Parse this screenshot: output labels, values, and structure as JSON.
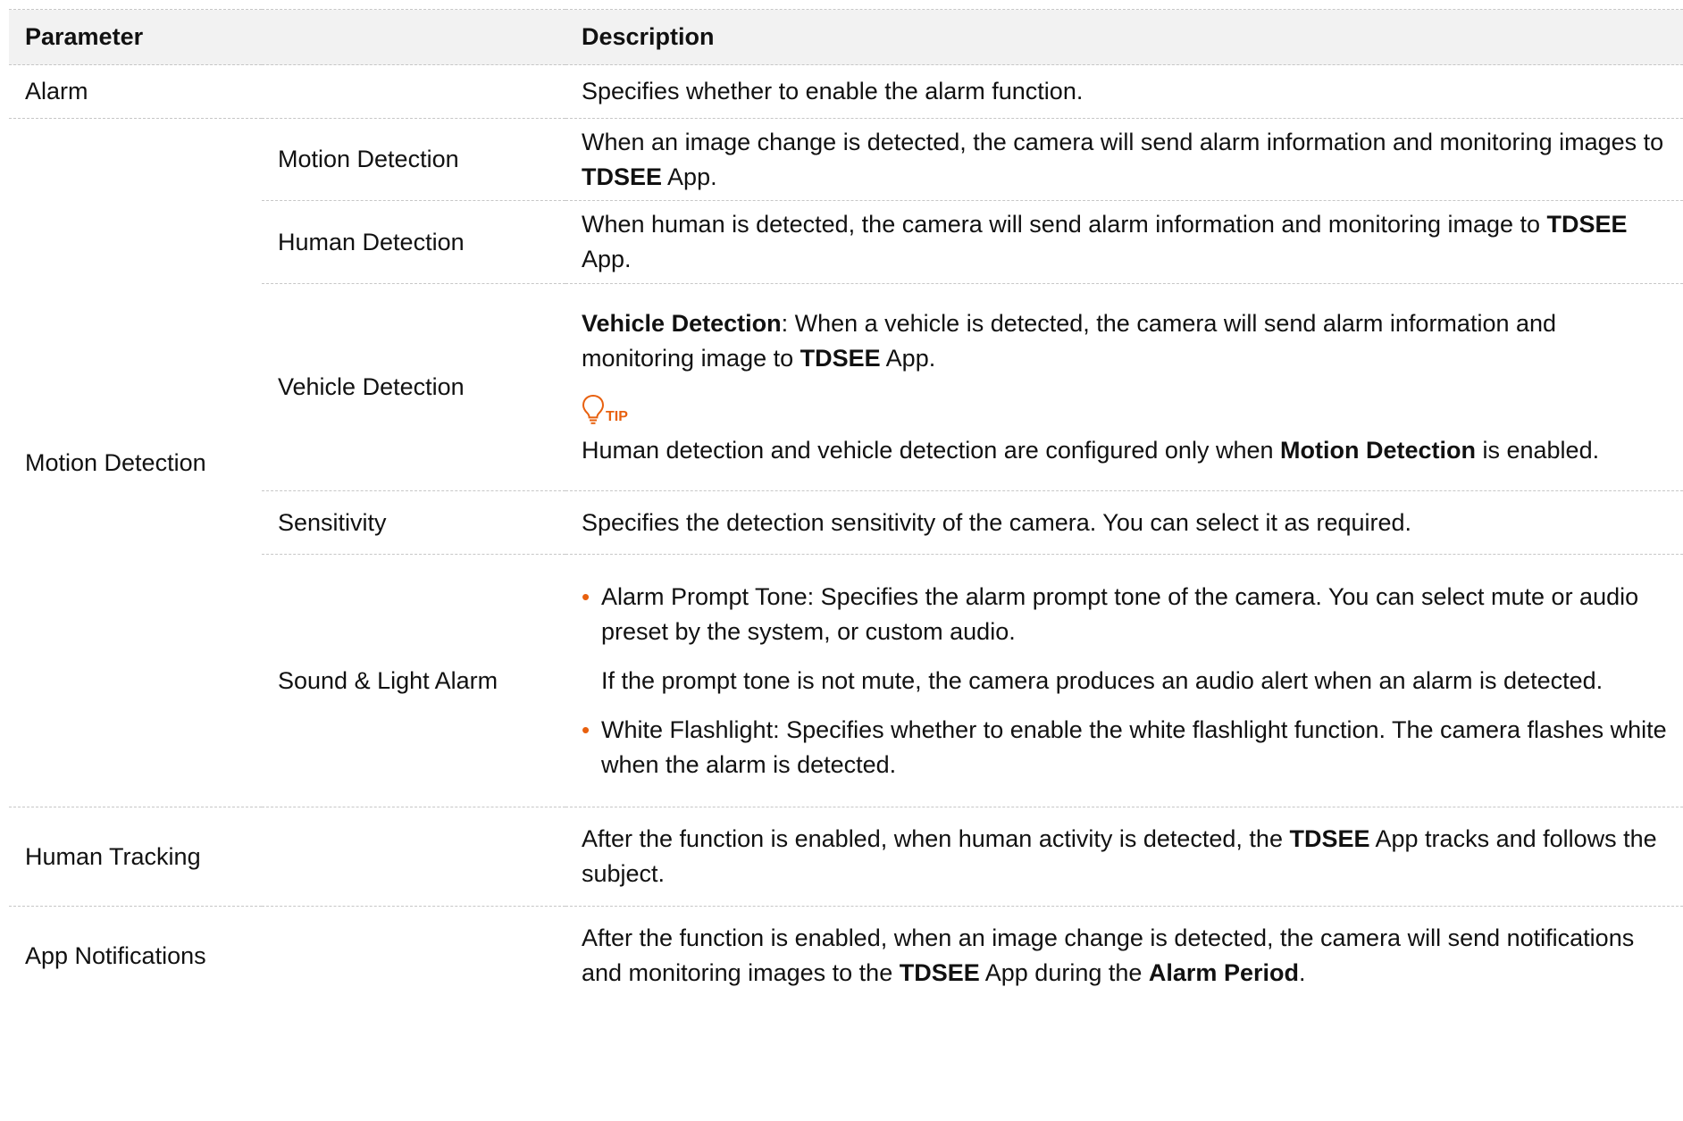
{
  "header": {
    "parameter": "Parameter",
    "description": "Description"
  },
  "rows": {
    "alarm": {
      "name": "Alarm",
      "description": "Specifies whether to enable the alarm function."
    },
    "motion_group": {
      "name": "Motion Detection",
      "motion": {
        "name": "Motion Detection",
        "desc_part1": "When an image change is detected, the camera will send alarm information and monitoring images to ",
        "desc_bold": "TDSEE",
        "desc_part2": " App."
      },
      "human": {
        "name": "Human Detection",
        "desc_part1": "When human is detected, the camera will send alarm information and monitoring image to ",
        "desc_bold": "TDSEE",
        "desc_part2": " App."
      },
      "vehicle": {
        "name": "Vehicle Detection",
        "desc_bold1": "Vehicle Detection",
        "desc_part1": ": When a vehicle is detected, the camera will send alarm information and monitoring image to ",
        "desc_bold2": "TDSEE",
        "desc_part2": " App.",
        "tip_label": "TIP",
        "tip_part1": "Human detection and vehicle detection are configured only when ",
        "tip_bold": "Motion Detection",
        "tip_part2": " is enabled."
      },
      "sensitivity": {
        "name": "Sensitivity",
        "description": "Specifies the detection sensitivity of the camera. You can select it as required."
      },
      "sound_light": {
        "name": "Sound & Light Alarm",
        "bullet1": "Alarm Prompt Tone: Specifies the alarm prompt tone of the camera. You can select mute or audio preset by the system, or custom audio.",
        "bullet1_note": "If the prompt tone is not mute, the camera produces an audio alert when an alarm is detected.",
        "bullet2": "White Flashlight: Specifies whether to enable the white flashlight function. The camera flashes white when the alarm is detected."
      }
    },
    "human_tracking": {
      "name": "Human Tracking",
      "desc_part1": "After the function is enabled, when human activity is detected, the ",
      "desc_bold": "TDSEE",
      "desc_part2": " App tracks and follows the subject."
    },
    "app_notifications": {
      "name": "App Notifications",
      "desc_part1": "After the function is enabled, when an image change is detected, the camera will send notifications and monitoring images to the ",
      "desc_bold1": "TDSEE",
      "desc_part2": " App during the ",
      "desc_bold2": "Alarm Period",
      "desc_part3": "."
    }
  },
  "colors": {
    "accent": "#e8600e",
    "header_bg": "#f2f2f2",
    "rule": "#c7c7c7"
  }
}
